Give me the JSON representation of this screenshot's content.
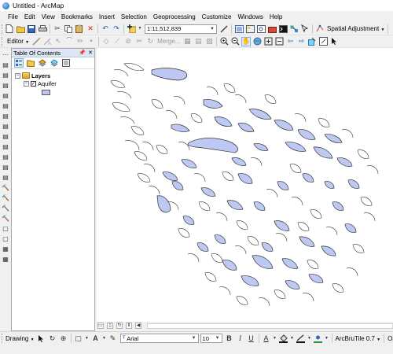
{
  "window": {
    "title": "Untitled - ArcMap"
  },
  "menubar": {
    "items": [
      "File",
      "Edit",
      "View",
      "Bookmarks",
      "Insert",
      "Selection",
      "Geoprocessing",
      "Customize",
      "Windows",
      "Help"
    ]
  },
  "standard_toolbar": {
    "scale": "1:11,512,839",
    "spatial_adjustment": "Spatial Adjustment"
  },
  "editor_toolbar": {
    "editor": "Editor",
    "merge": "Merge..."
  },
  "toc": {
    "title": "Table Of Contents",
    "tree": {
      "root_label": "Layers",
      "layer_label": "Aquifer",
      "layer_checked": "✓",
      "fill_color": "#bdc9f2"
    }
  },
  "map": {
    "feature_fill": "#bdc9f2",
    "feature_stroke": "#333333"
  },
  "drawing_toolbar": {
    "drawing": "Drawing",
    "font_name": "Arial",
    "font_size": "10",
    "bold": "B",
    "italic": "I",
    "underline": "U",
    "arcbru": "ArcBruTile 0.7",
    "op": "Op"
  }
}
